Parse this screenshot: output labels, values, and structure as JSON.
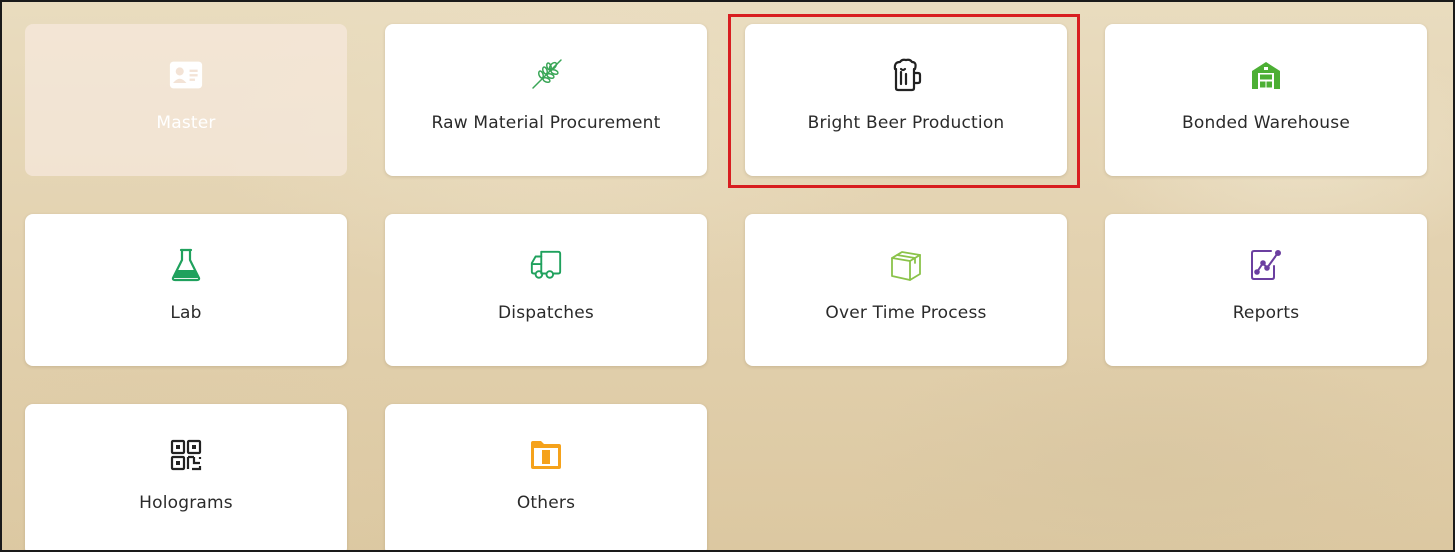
{
  "tiles": [
    {
      "label": "Master",
      "icon": "id-card-icon",
      "color": "#ffffff",
      "state": "disabled"
    },
    {
      "label": "Raw Material Procurement",
      "icon": "wheat-icon",
      "color": "#3aa657"
    },
    {
      "label": "Bright Beer Production",
      "icon": "beer-mug-icon",
      "color": "#222222",
      "state": "highlighted"
    },
    {
      "label": "Bonded Warehouse",
      "icon": "warehouse-icon",
      "color": "#4caf34"
    },
    {
      "label": "Lab",
      "icon": "flask-icon",
      "color": "#1fa15d"
    },
    {
      "label": "Dispatches",
      "icon": "truck-icon",
      "color": "#1fa15d"
    },
    {
      "label": "Over Time Process",
      "icon": "box-icon",
      "color": "#8bc34a"
    },
    {
      "label": "Reports",
      "icon": "chart-report-icon",
      "color": "#6b3fa0"
    },
    {
      "label": "Holograms",
      "icon": "qr-code-icon",
      "color": "#222222"
    },
    {
      "label": "Others",
      "icon": "folder-icon",
      "color": "#f5a21b"
    }
  ],
  "highlight_color": "#d81e20"
}
